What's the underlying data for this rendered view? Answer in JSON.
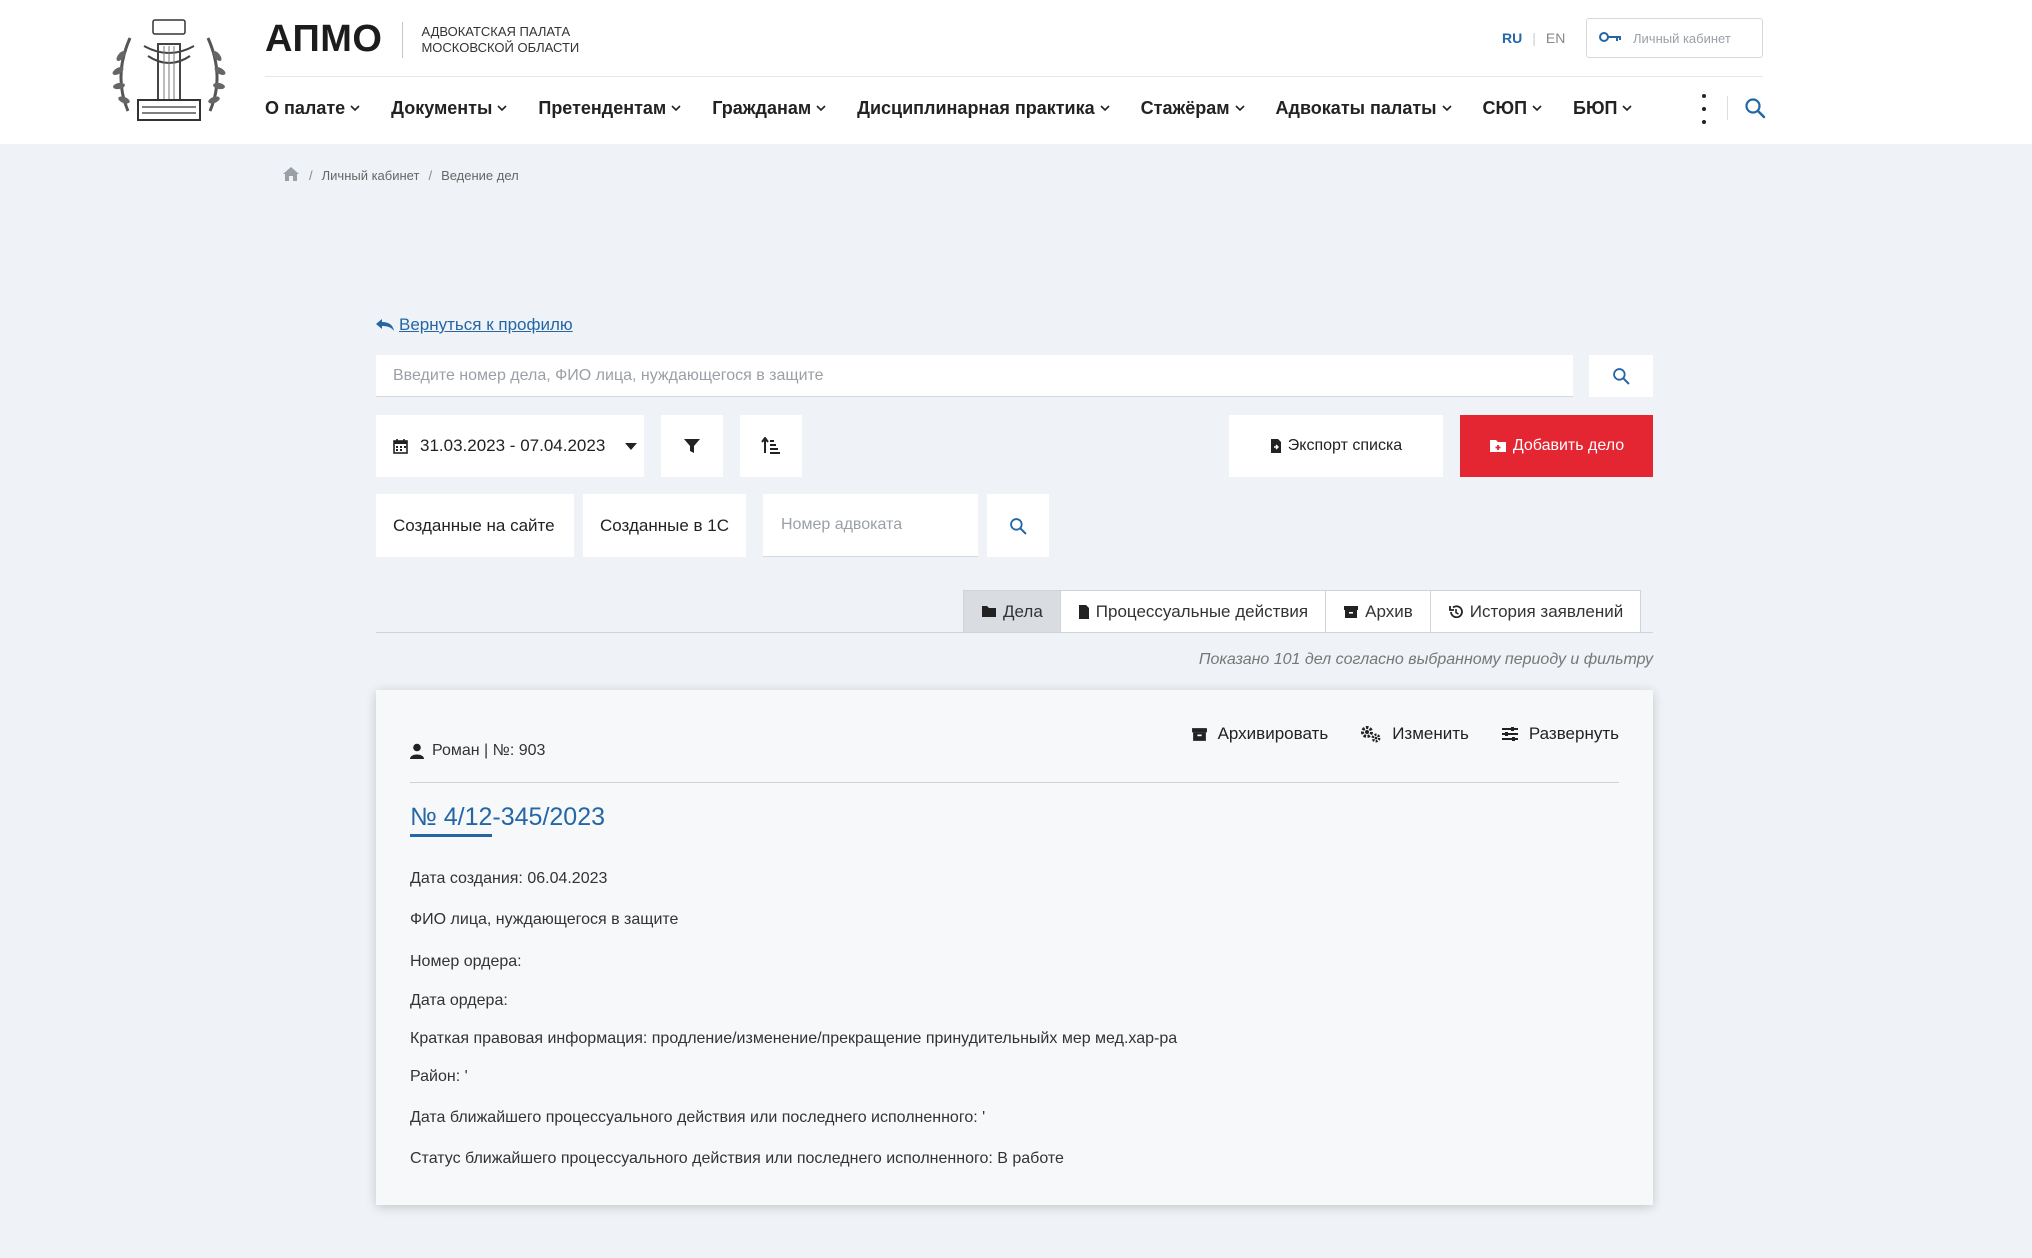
{
  "header": {
    "brand_name": "АПМО",
    "brand_sub_line1": "АДВОКАТСКАЯ ПАЛАТА",
    "brand_sub_line2": "МОСКОВСКОЙ ОБЛАСТИ",
    "lang_ru": "RU",
    "lang_en": "EN",
    "cabinet_label": "Личный кабинет"
  },
  "nav": {
    "items": [
      {
        "label": "О палате"
      },
      {
        "label": "Документы"
      },
      {
        "label": "Претендентам"
      },
      {
        "label": "Гражданам"
      },
      {
        "label": "Дисциплинарная практика"
      },
      {
        "label": "Стажёрам"
      },
      {
        "label": "Адвокаты палаты"
      },
      {
        "label": "СЮП"
      },
      {
        "label": "БЮП"
      }
    ]
  },
  "breadcrumb": {
    "level1": "Личный кабинет",
    "level2": "Ведение дел"
  },
  "back_link": "Вернуться к профилю",
  "search": {
    "placeholder": "Введите номер дела, ФИО лица, нуждающегося в защите",
    "value": ""
  },
  "filters": {
    "date_range": "31.03.2023 - 07.04.2023",
    "export_label": "Экспорт списка",
    "add_label": "Добавить дело",
    "created_site": "Созданные на сайте",
    "created_1c": "Созданные в 1С",
    "lawyer_placeholder": "Номер адвоката"
  },
  "tabs": [
    {
      "label": "Дела"
    },
    {
      "label": "Процессуальные действия"
    },
    {
      "label": "Архив"
    },
    {
      "label": "История заявлений"
    }
  ],
  "shown_note": "Показано 101 дел согласно выбранному периоду и фильтру",
  "case": {
    "user": "Роман | №: 903",
    "archive_label": "Архивировать",
    "edit_label": "Изменить",
    "expand_label": "Развернуть",
    "number": "№ 4/12-345/2023",
    "created": "Дата создания: 06.04.2023",
    "person": "ФИО лица, нуждающегося в защите",
    "order_number": "Номер ордера:",
    "order_date": "Дата ордера:",
    "legal_info": "Краткая правовая информация: продление/изменение/прекращение принудительныйх мер мед.хар-ра",
    "district": "Район: '",
    "nearest_date": "Дата ближайшего процессуального действия или последнего исполненного: '",
    "nearest_status": "Статус ближайшего процессуального действия или последнего исполненного: В работе"
  },
  "colors": {
    "accent_blue": "#2466a6",
    "add_red": "#e42532",
    "page_bg": "#eff2f6"
  }
}
